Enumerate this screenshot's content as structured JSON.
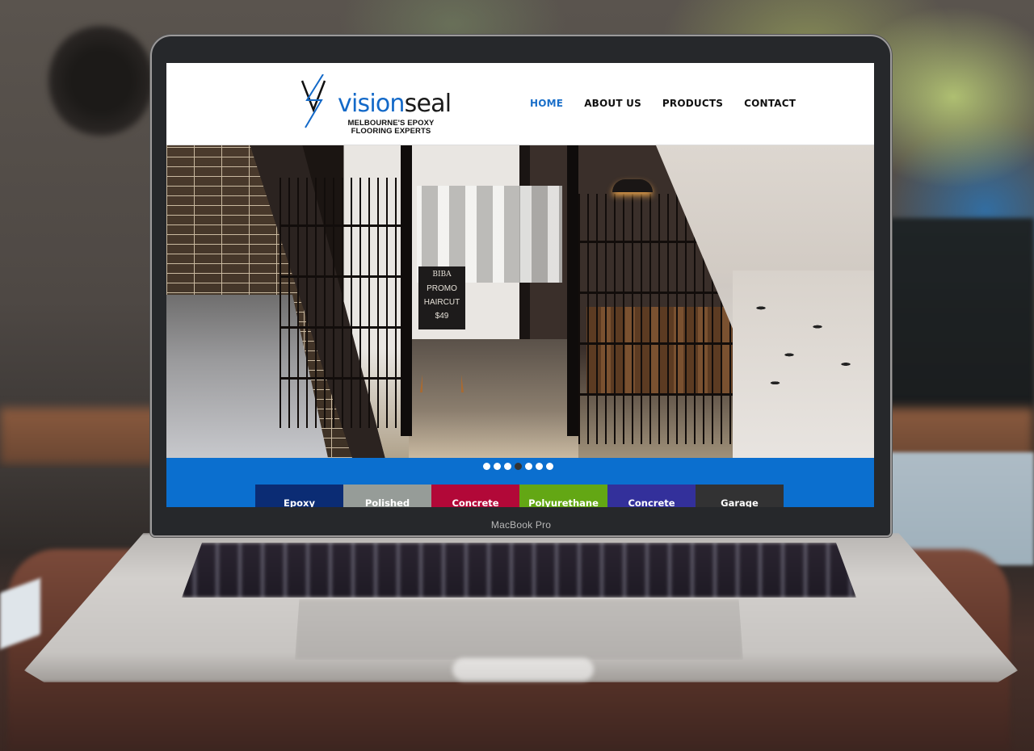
{
  "device": {
    "label": "MacBook Pro"
  },
  "site": {
    "logo": {
      "word_part1": "vision",
      "word_part2": "seal",
      "tagline_line1": "MELBOURNE'S EPOXY",
      "tagline_line2": "FLOORING EXPERTS",
      "icon": "v-lightning-logo-icon"
    },
    "nav": [
      {
        "label": "HOME",
        "active": true
      },
      {
        "label": "ABOUT US",
        "active": false
      },
      {
        "label": "PRODUCTS",
        "active": false
      },
      {
        "label": "CONTACT",
        "active": false
      }
    ],
    "hero": {
      "sign": {
        "brand": "BIBA",
        "line1": "PROMO",
        "line2": "HAIRCUT",
        "price": "$49"
      },
      "slides_total": 7,
      "active_slide": 4
    },
    "categories": [
      {
        "label": "Epoxy",
        "color": "#0b2c74"
      },
      {
        "label": "Polished",
        "color": "#969c98"
      },
      {
        "label": "Concrete",
        "color": "#b20838"
      },
      {
        "label": "Polyurethane",
        "color": "#63a714"
      },
      {
        "label": "Concrete",
        "color": "#33309b"
      },
      {
        "label": "Garage",
        "color": "#323233"
      }
    ],
    "colors": {
      "brand_blue": "#1369c8",
      "slider_bar": "#0b6fcf",
      "nav_active": "#1a6fc9"
    }
  }
}
